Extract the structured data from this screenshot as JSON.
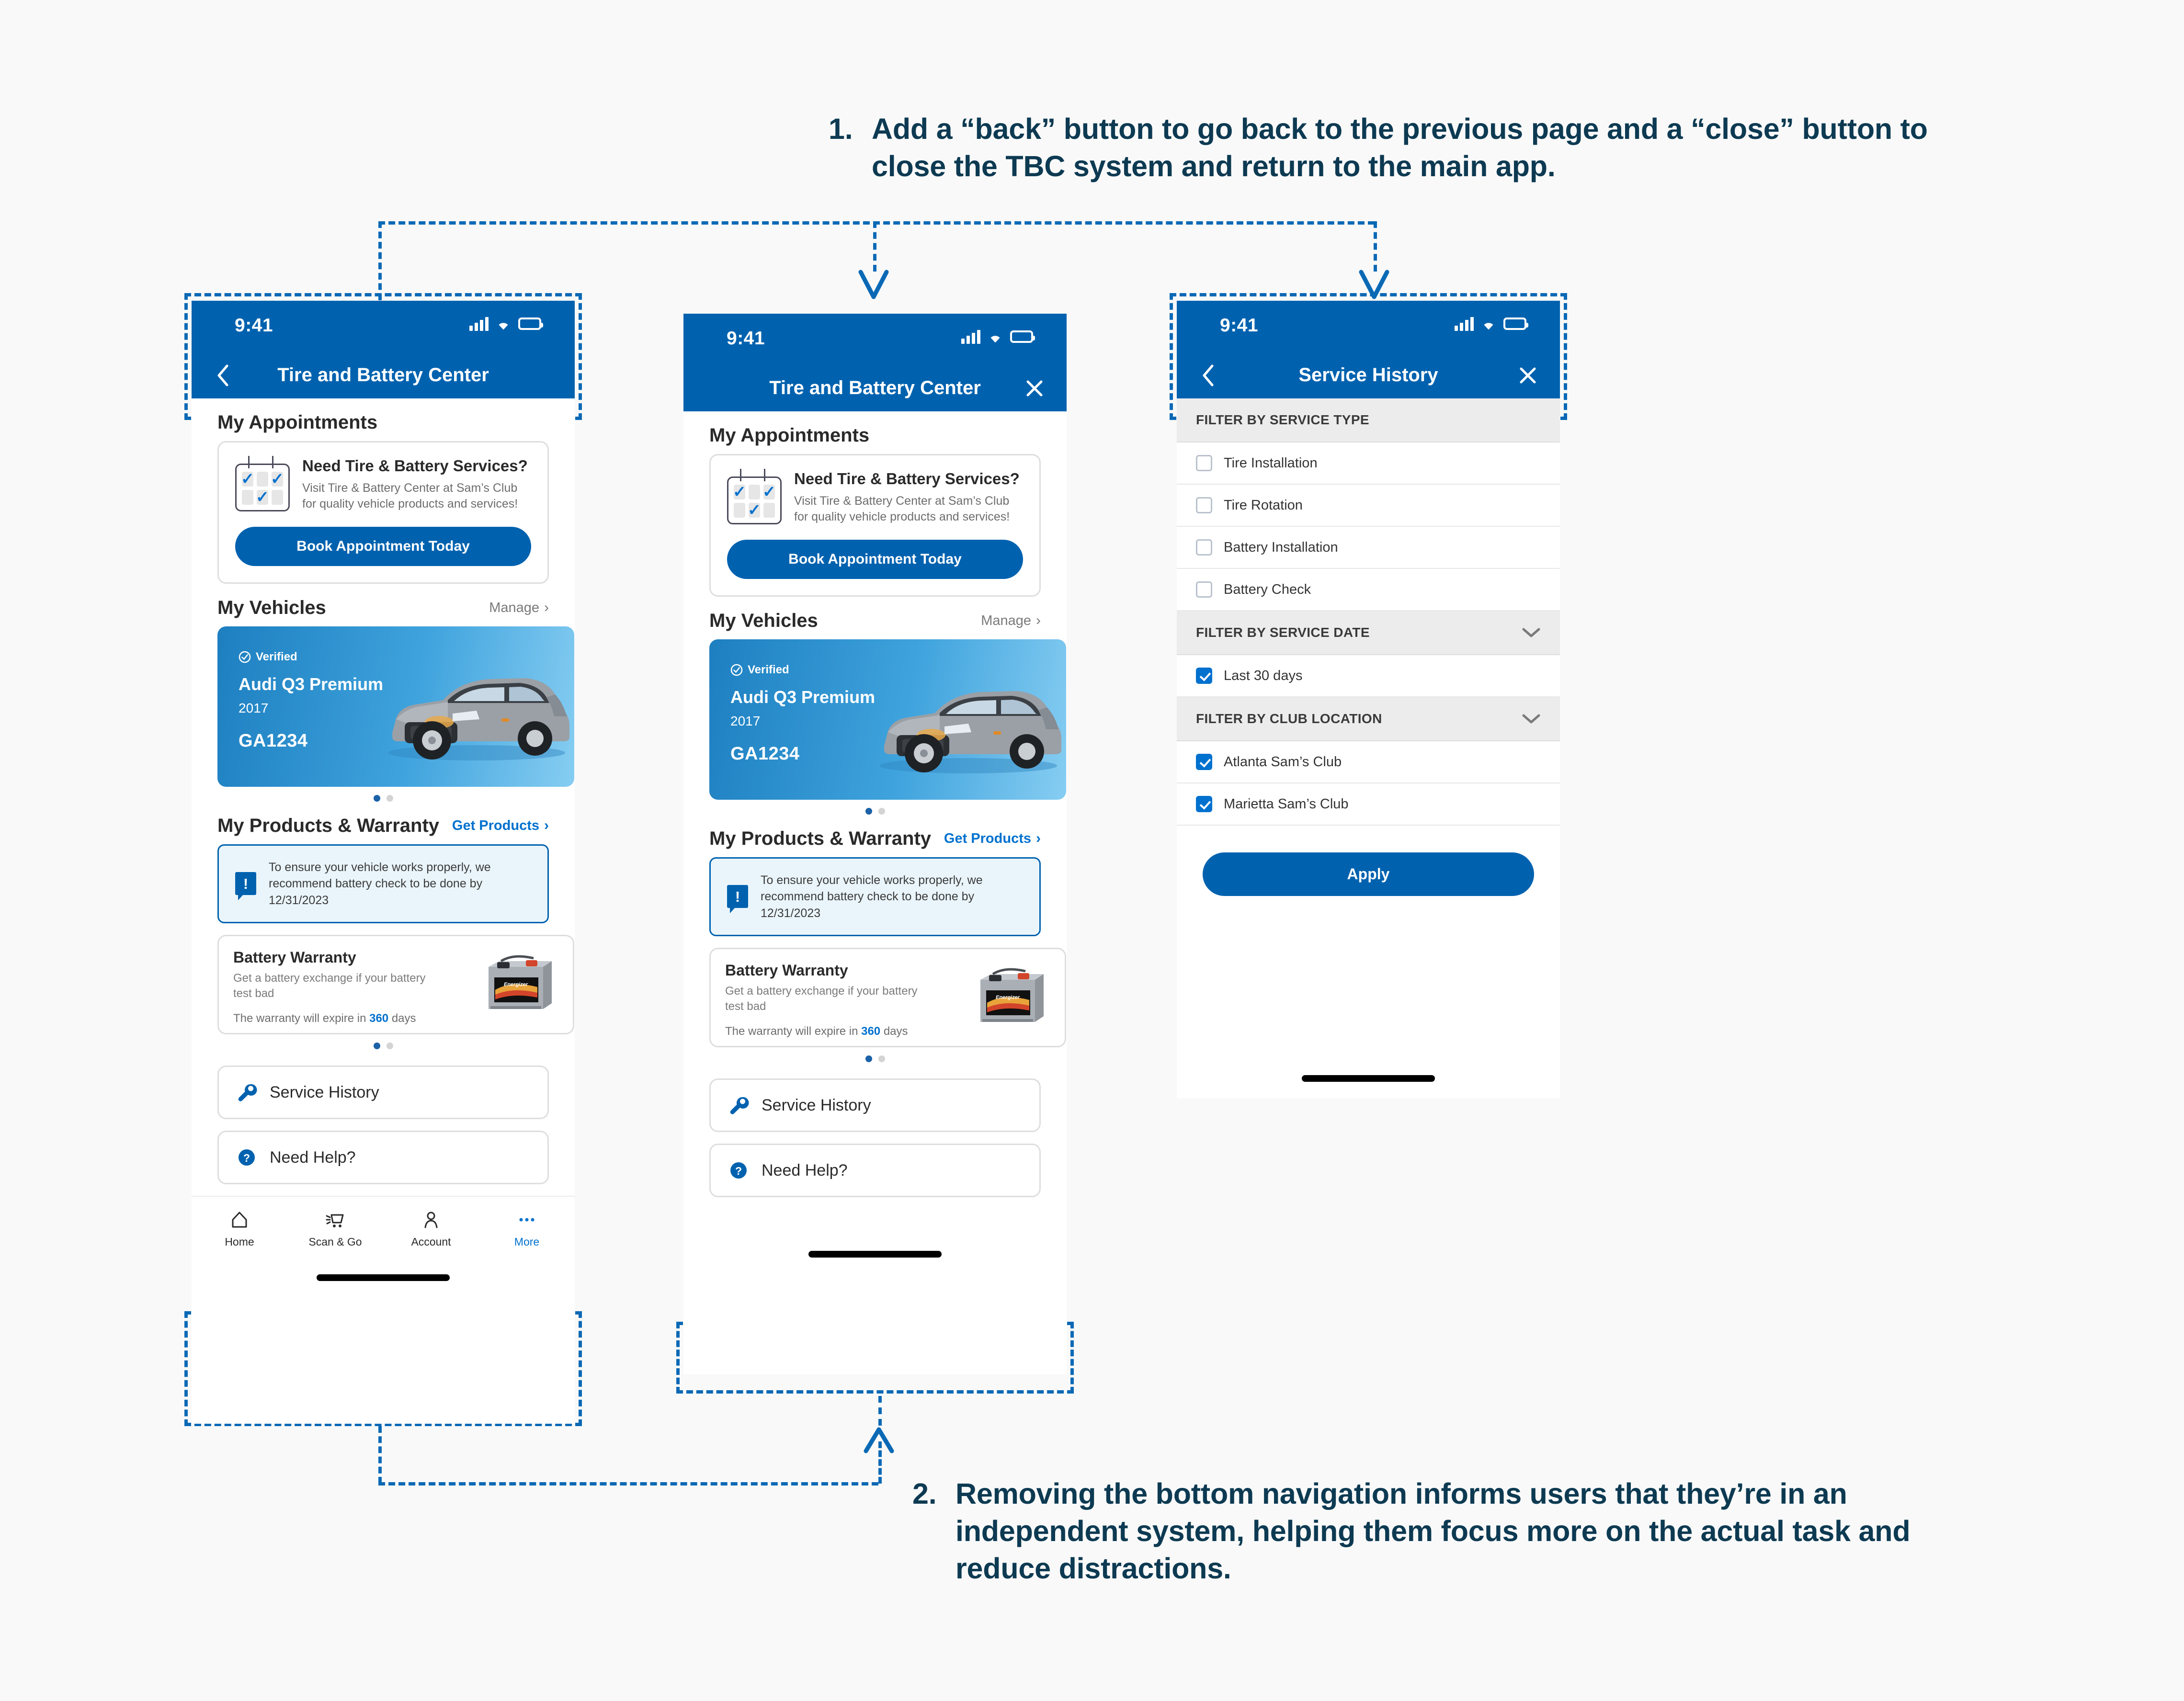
{
  "annotations": [
    {
      "number": "1.",
      "text": "Add a “back” button to go back to the previous page and a “close” button to close the TBC system and return to the main app."
    },
    {
      "number": "2.",
      "text": "Removing the bottom navigation informs users that they’re in an independent system, helping them focus more on the actual task and reduce distractions."
    }
  ],
  "colors": {
    "brand_blue": "#0062AF",
    "link_blue": "#0071CE",
    "annotation_navy": "#0D3A52",
    "callout_blue": "#0A69B5",
    "page_bg": "#F9F9F9"
  },
  "status_bar": {
    "time": "9:41",
    "icons": [
      "cellular-signal-icon",
      "wifi-icon",
      "battery-icon"
    ]
  },
  "screen1": {
    "nav": {
      "title": "Tire and Battery Center",
      "back_icon": "chevron-left-icon",
      "has_close": false
    },
    "appointments": {
      "heading": "My Appointments",
      "card_title": "Need Tire & Battery Services?",
      "card_body": "Visit Tire & Battery Center at Sam’s Club for quality vehicle products and services!",
      "cta": "Book Appointment Today",
      "icon": "calendar-check-icon"
    },
    "vehicles": {
      "heading": "My Vehicles",
      "link": "Manage",
      "verified_badge": "Verified",
      "name": "Audi Q3 Premium",
      "year": "2017",
      "plate": "GA1234",
      "dots": 2,
      "active_dot": 0
    },
    "products": {
      "heading": "My Products & Warranty",
      "link": "Get Products",
      "alert": "To ensure your vehicle works properly, we recommend battery check to be done by 12/31/2023",
      "warranty_title": "Battery Warranty",
      "warranty_sub": "Get a battery exchange if your battery test bad",
      "warranty_expiry_prefix": "The warranty will expire in ",
      "warranty_expiry_days": "360",
      "warranty_expiry_suffix": " days",
      "dots": 2,
      "active_dot": 0
    },
    "rows": [
      {
        "label": "Service History",
        "icon": "wrench-icon"
      },
      {
        "label": "Need Help?",
        "icon": "question-circle-icon"
      }
    ],
    "bottom_nav": [
      {
        "label": "Home",
        "icon": "home-icon",
        "active": false
      },
      {
        "label": "Scan & Go",
        "icon": "scan-cart-icon",
        "active": false
      },
      {
        "label": "Account",
        "icon": "person-icon",
        "active": false
      },
      {
        "label": "More",
        "icon": "ellipsis-icon",
        "active": true
      }
    ]
  },
  "screen2": {
    "nav": {
      "title": "Tire and Battery Center",
      "close_icon": "close-x-icon",
      "has_back": false
    },
    "appointments": {
      "heading": "My Appointments",
      "card_title": "Need Tire & Battery Services?",
      "card_body": "Visit Tire & Battery Center at Sam’s Club for quality vehicle products and services!",
      "cta": "Book Appointment Today",
      "icon": "calendar-check-icon"
    },
    "vehicles": {
      "heading": "My Vehicles",
      "link": "Manage",
      "verified_badge": "Verified",
      "name": "Audi Q3 Premium",
      "year": "2017",
      "plate": "GA1234",
      "dots": 2,
      "active_dot": 0
    },
    "products": {
      "heading": "My Products & Warranty",
      "link": "Get Products",
      "alert": "To ensure your vehicle works properly, we recommend battery check to be done by 12/31/2023",
      "warranty_title": "Battery Warranty",
      "warranty_sub": "Get a battery exchange if your battery test bad",
      "warranty_expiry_prefix": "The warranty will expire in ",
      "warranty_expiry_days": "360",
      "warranty_expiry_suffix": " days",
      "dots": 2,
      "active_dot": 0
    },
    "rows": [
      {
        "label": "Service History",
        "icon": "wrench-icon"
      },
      {
        "label": "Need Help?",
        "icon": "question-circle-icon"
      }
    ]
  },
  "screen3": {
    "nav": {
      "title": "Service History",
      "back_icon": "chevron-left-icon",
      "close_icon": "close-x-icon"
    },
    "filters": [
      {
        "heading": "FILTER BY SERVICE TYPE",
        "collapsible": false,
        "options": [
          {
            "label": "Tire Installation",
            "checked": false
          },
          {
            "label": "Tire Rotation",
            "checked": false
          },
          {
            "label": "Battery Installation",
            "checked": false
          },
          {
            "label": "Battery Check",
            "checked": false
          }
        ]
      },
      {
        "heading": "FILTER BY SERVICE DATE",
        "collapsible": true,
        "options": [
          {
            "label": "Last 30 days",
            "checked": true
          }
        ]
      },
      {
        "heading": "FILTER BY CLUB LOCATION",
        "collapsible": true,
        "options": [
          {
            "label": "Atlanta Sam’s Club",
            "checked": true
          },
          {
            "label": "Marietta Sam’s Club",
            "checked": true
          }
        ]
      }
    ],
    "apply_label": "Apply"
  }
}
